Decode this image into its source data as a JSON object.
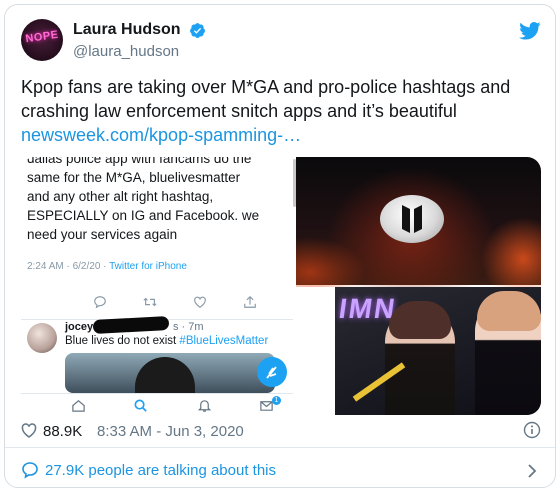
{
  "author": {
    "display_name": "Laura Hudson",
    "handle": "@laura_hudson",
    "avatar_text": "NOPE",
    "verified": true
  },
  "tweet": {
    "text": "Kpop fans are taking over M*GA and pro-police hashtags and crashing law enforcement snitch apps and it’s beautiful ",
    "link": "newsweek.com/kpop-spamming-…"
  },
  "media": {
    "screenshot_tweet": {
      "lines": [
        "dallas police app with fancams do the",
        "same for the M*GA, bluelivesmatter",
        "and any other alt right hashtag,",
        "ESPECIALLY on IG and Facebook. we",
        "need your services again"
      ],
      "meta": "2:24 AM · 6/2/20 · ",
      "client": "Twitter for iPhone"
    },
    "reply": {
      "name": "jocey",
      "time": "s · 7m",
      "text": "Blue lives do not exist ",
      "hashtag": "#BlueLivesMatter"
    },
    "tabbar_badge": "1",
    "neon_text": "IMN"
  },
  "footer": {
    "likes": "88.9K",
    "timestamp": "8:33 AM - Jun 3, 2020",
    "talking": "27.9K people are talking about this"
  },
  "colors": {
    "accent": "#1b95e0",
    "verified": "#1da1f2",
    "text": "#14171a",
    "muted": "#657786"
  }
}
